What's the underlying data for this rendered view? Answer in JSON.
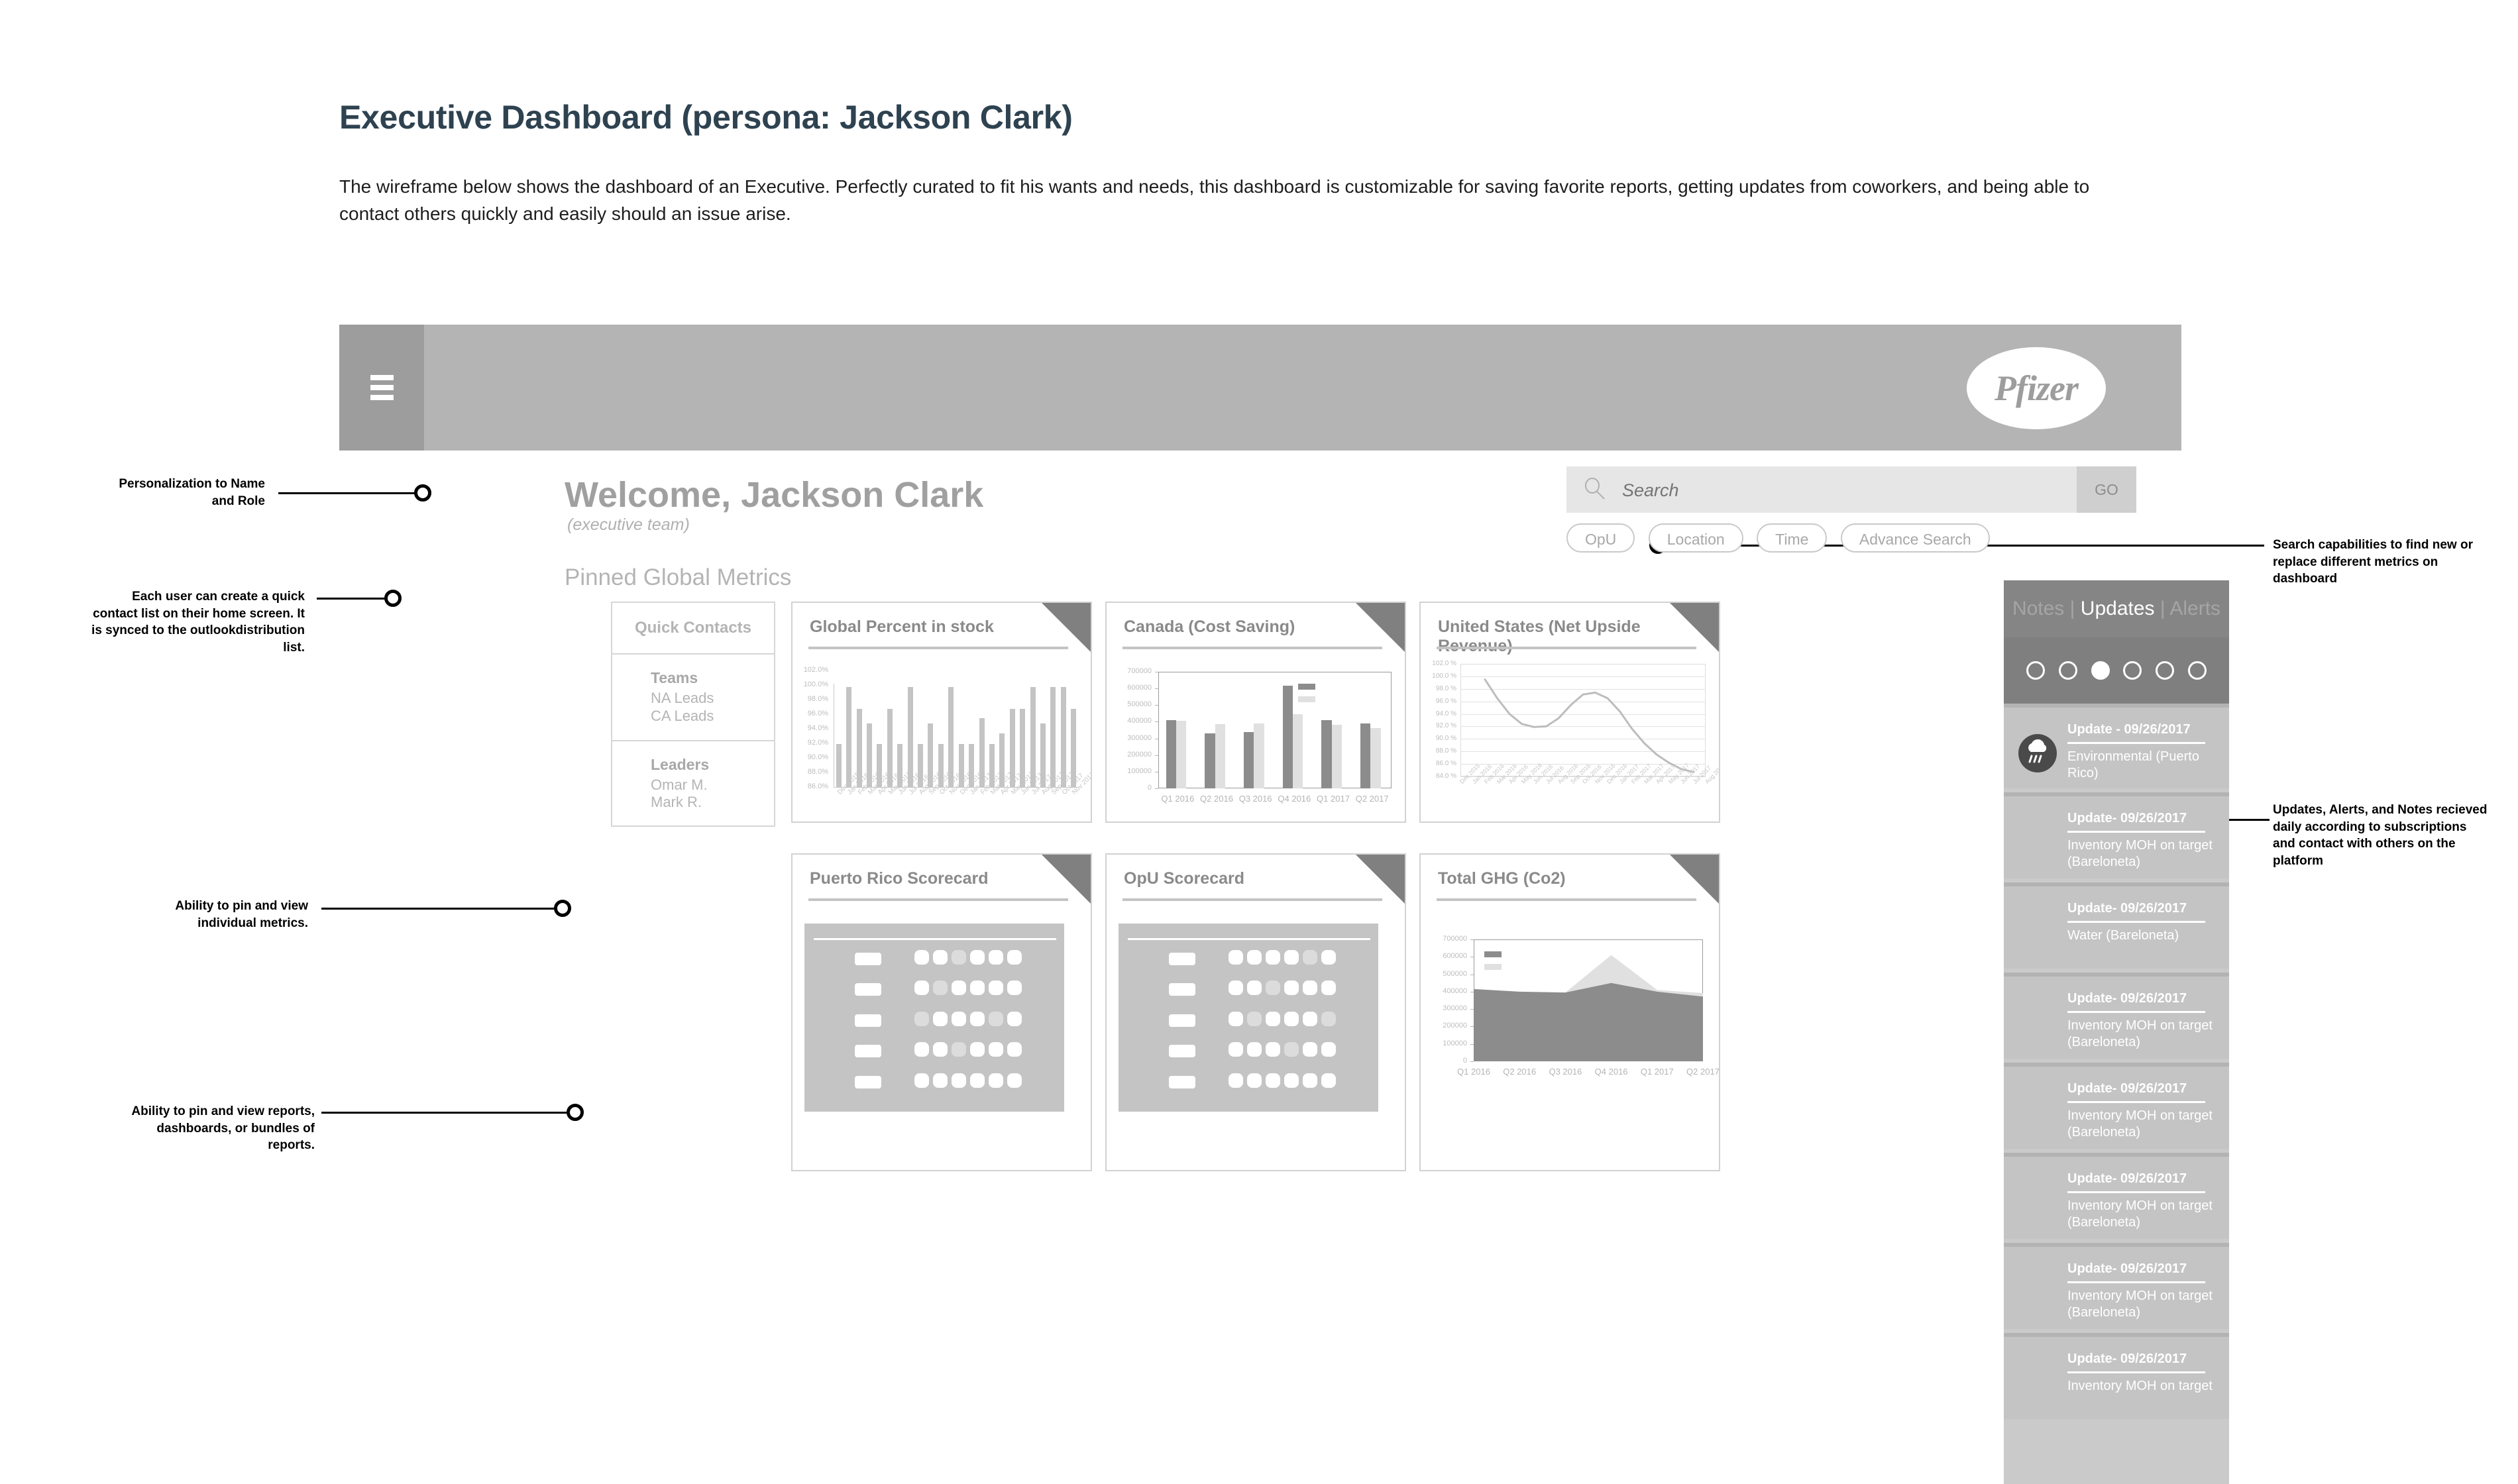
{
  "page": {
    "title": "Executive Dashboard (persona: Jackson Clark)",
    "description": "The wireframe below shows the dashboard of an Executive. Perfectly curated to fit his wants and needs, this dashboard is customizable for saving favorite reports, getting updates from coworkers, and being able to contact others quickly and easily should an issue arise."
  },
  "annotations": {
    "left": [
      {
        "text": "Personalization to Name and Role"
      },
      {
        "text": "Each user can create a quick contact list on their home screen.  It is synced to the outlookdistribution list."
      },
      {
        "text": "Ability to pin  and view individual metrics."
      },
      {
        "text": "Ability to pin and view reports, dashboards, or bundles of reports."
      }
    ],
    "right": [
      {
        "text": "Search capabilities to find new or replace different metrics on dashboard"
      },
      {
        "text": "Updates, Alerts, and Notes recieved daily according to subscriptions and contact with others on the platform"
      }
    ]
  },
  "app": {
    "brand": "Pfizer",
    "menu_icon": "hamburger-icon",
    "welcome": "Welcome, Jackson Clark",
    "welcome_sub": "(executive team)",
    "section_heading": "Pinned Global Metrics",
    "search": {
      "placeholder": "Search",
      "value": "",
      "go_label": "GO",
      "icon": "search-icon",
      "filters": [
        "OpU",
        "Location",
        "Time",
        "Advance Search"
      ]
    },
    "quick_contacts": {
      "title": "Quick Contacts",
      "groups": [
        {
          "heading": "Teams",
          "items": [
            "NA Leads",
            "CA Leads"
          ]
        },
        {
          "heading": "Leaders",
          "items": [
            "Omar M.",
            "Mark R."
          ]
        }
      ]
    },
    "cards": [
      {
        "title": "Global Percent in stock"
      },
      {
        "title": "Canada (Cost Saving)"
      },
      {
        "title": "United States (Net Upside Revenue)"
      },
      {
        "title": "Puerto Rico Scorecard"
      },
      {
        "title": "OpU Scorecard"
      },
      {
        "title": "Total GHG (Co2)"
      }
    ],
    "notifications": {
      "tabs": [
        {
          "label": "Notes",
          "active": false
        },
        {
          "label": "Updates",
          "active": true
        },
        {
          "label": "Alerts",
          "active": false
        }
      ],
      "separator": "|",
      "pager": {
        "count": 6,
        "active_index": 2
      },
      "items": [
        {
          "date": "Update - 09/26/2017",
          "body": "Environmental (Puerto Rico)",
          "icon": "storm-cloud-icon"
        },
        {
          "date": "Update- 09/26/2017",
          "body": "Inventory MOH on target (Bareloneta)",
          "icon": ""
        },
        {
          "date": "Update- 09/26/2017",
          "body": "Water (Bareloneta)",
          "icon": ""
        },
        {
          "date": "Update- 09/26/2017",
          "body": "Inventory MOH on target (Bareloneta)",
          "icon": ""
        },
        {
          "date": "Update- 09/26/2017",
          "body": "Inventory MOH on target (Bareloneta)",
          "icon": ""
        },
        {
          "date": "Update- 09/26/2017",
          "body": "Inventory MOH on target (Bareloneta)",
          "icon": ""
        },
        {
          "date": "Update- 09/26/2017",
          "body": "Inventory MOH on target (Bareloneta)",
          "icon": ""
        },
        {
          "date": "Update- 09/26/2017",
          "body": "Inventory MOH on target",
          "icon": ""
        }
      ]
    }
  },
  "colors": {
    "heading": "#2e4250",
    "chrome": "#b4b4b4",
    "chrome_dark": "#9d9d9d",
    "rail": "#cacaca",
    "rail_header": "#858585",
    "series_dark": "#8c8c8c",
    "series_light": "#e0e0e0",
    "bar": "#c4c4c4"
  },
  "chart_data": [
    {
      "id": "global-percent-in-stock",
      "type": "bar",
      "title": "Global Percent in stock",
      "xlabel": "",
      "ylabel": "",
      "ylim": [
        86.0,
        102.0
      ],
      "ytick_labels": [
        "102.0%",
        "100.0%",
        "98.0%",
        "96.0%",
        "94.0%",
        "92.0%",
        "90.0%",
        "88.0%",
        "86.0%"
      ],
      "grid": false,
      "legend": "none",
      "categories": [
        "Dec 2015",
        "Jan 2016",
        "Feb 2016",
        "Mar 2016",
        "Apr 2016",
        "May 2016",
        "Jun 2016",
        "Jul 2016",
        "Aug 2016",
        "Sep 2016",
        "Oct 2016",
        "Nov 2016",
        "Dec 2016",
        "Jan 2017",
        "Feb 2017",
        "Mar 2017",
        "Apr 2017",
        "May 2017",
        "Jun 2017",
        "Jul 2017",
        "Aug 2017",
        "Sep 2017",
        "Oct 2017",
        "Nov 2017"
      ],
      "values": [
        91.9,
        99.7,
        96.7,
        94.7,
        91.9,
        96.7,
        91.9,
        99.7,
        91.9,
        94.7,
        91.9,
        99.7,
        91.9,
        91.9,
        95.5,
        91.9,
        93.4,
        96.7,
        96.7,
        99.7,
        94.7,
        99.7,
        99.7,
        96.7
      ]
    },
    {
      "id": "canada-cost-saving",
      "type": "bar",
      "title": "Canada (Cost Saving)",
      "xlabel": "",
      "ylabel": "",
      "ylim": [
        0,
        700000
      ],
      "ytick_labels": [
        "700000",
        "600000",
        "500000",
        "400000",
        "300000",
        "200000",
        "100000",
        "0"
      ],
      "grid": false,
      "legend": "inside-right",
      "categories": [
        "Q1 2016",
        "Q2 2016",
        "Q3 2016",
        "Q4 2016",
        "Q1 2017",
        "Q2 2017"
      ],
      "series": [
        {
          "name": "",
          "values": [
            410000,
            330000,
            340000,
            615000,
            410000,
            390000
          ]
        },
        {
          "name": "",
          "values": [
            407000,
            385000,
            388000,
            445000,
            382000,
            360000
          ]
        }
      ]
    },
    {
      "id": "united-states-net-upside-revenue",
      "type": "line",
      "title": "United States (Net Upside Revenue)",
      "xlabel": "",
      "ylabel": "",
      "ylim": [
        84.0,
        102.0
      ],
      "ytick_labels": [
        "102.0 %",
        "100.0 %",
        "98.0 %",
        "96.0 %",
        "94.0 %",
        "92.0 %",
        "90.0 %",
        "88.0 %",
        "86.0 %",
        "84.0 %"
      ],
      "grid": true,
      "legend": "none",
      "categories": [
        "Dec 2015",
        "Jan 2016",
        "Feb 2016",
        "Mar 2016",
        "Apr 2016",
        "May 2016",
        "Jun 2016",
        "Jul 2016",
        "Aug 2016",
        "Sep 2016",
        "Oct 2016",
        "Nov 2016",
        "Dec 2016",
        "Jan 2017",
        "Feb 2017",
        "Mar 2017",
        "Apr 2017",
        "May 2017",
        "Jun 2017",
        "Jul 2017",
        "Aug 2017"
      ],
      "values": [
        null,
        null,
        99.5,
        96.5,
        94.0,
        92.4,
        91.9,
        92.0,
        93.3,
        95.4,
        97.1,
        97.4,
        96.5,
        94.4,
        91.6,
        89.3,
        87.5,
        86.2,
        85.2,
        84.7,
        null
      ]
    },
    {
      "id": "total-ghg-co2",
      "type": "area",
      "title": "Total GHG (Co2)",
      "xlabel": "",
      "ylabel": "",
      "ylim": [
        0,
        700000
      ],
      "ytick_labels": [
        "700000",
        "600000",
        "500000",
        "400000",
        "300000",
        "200000",
        "100000",
        "0"
      ],
      "grid": false,
      "legend": "inside-left",
      "stacked": true,
      "categories": [
        "Q1 2016",
        "Q2 2016",
        "Q3 2016",
        "Q4 2016",
        "Q1 2017",
        "Q2 2017"
      ],
      "series": [
        {
          "name": "",
          "values": [
            415000,
            400000,
            395000,
            450000,
            400000,
            372000
          ]
        },
        {
          "name": "",
          "values": [
            0,
            0,
            0,
            160000,
            10000,
            20000
          ]
        }
      ]
    },
    {
      "id": "puerto-rico-scorecard",
      "type": "table",
      "title": "Puerto Rico Scorecard",
      "rows": 5,
      "cols": 6,
      "note": "placeholder scorecard grid"
    },
    {
      "id": "opu-scorecard",
      "type": "table",
      "title": "OpU Scorecard",
      "rows": 5,
      "cols": 6,
      "note": "placeholder scorecard grid"
    }
  ]
}
